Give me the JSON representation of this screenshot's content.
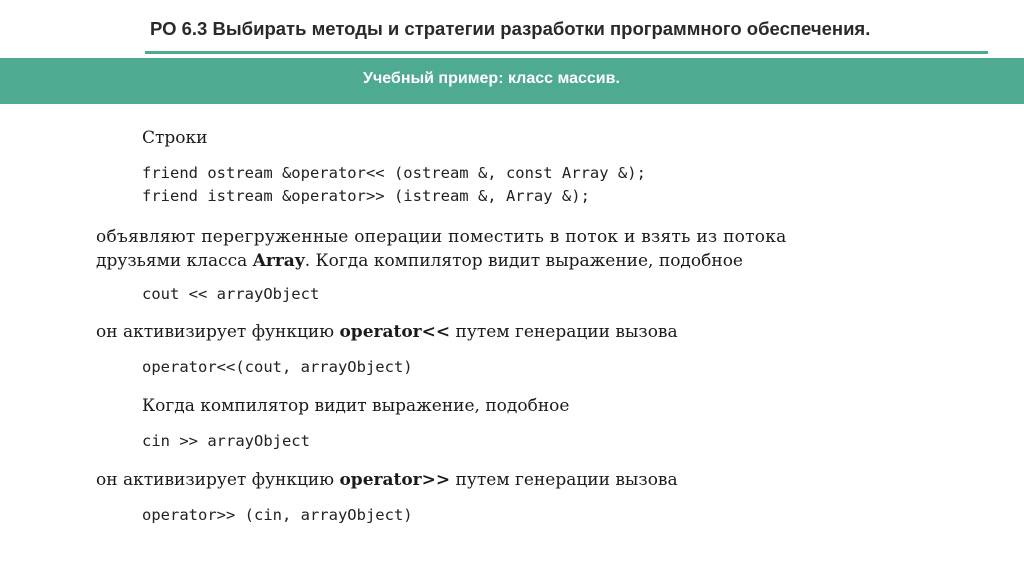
{
  "header": {
    "title": "РО 6.3 Выбирать методы и стратегии разработки программного обеспечения.",
    "banner": "Учебный пример: класс массив."
  },
  "body": {
    "intro": "Строки",
    "code1": "friend ostream &operator<< (ostream &, const Array &);",
    "code2": "friend istream &operator>> (istream &, Array &);",
    "para1_line1": "объявляют перегруженные операции поместить в поток и взять из потока",
    "para1_line2_pre": "друзьями класса ",
    "para1_line2_bold": "Array",
    "para1_line2_post": ". Когда компилятор видит выражение, подобное",
    "code3": "cout << arrayObject",
    "para2_pre": "он активизирует функцию ",
    "para2_bold": "operator<<",
    "para2_post": " путем генерации вызова",
    "code4": "operator<<(cout, arrayObject)",
    "para3": "Когда компилятор видит выражение, подобное",
    "code5": "cin >> arrayObject",
    "para4_pre": "он активизирует функцию ",
    "para4_bold": "operator>>",
    "para4_post": " путем генерации вызова",
    "code6": "operator>> (cin, arrayObject)"
  }
}
